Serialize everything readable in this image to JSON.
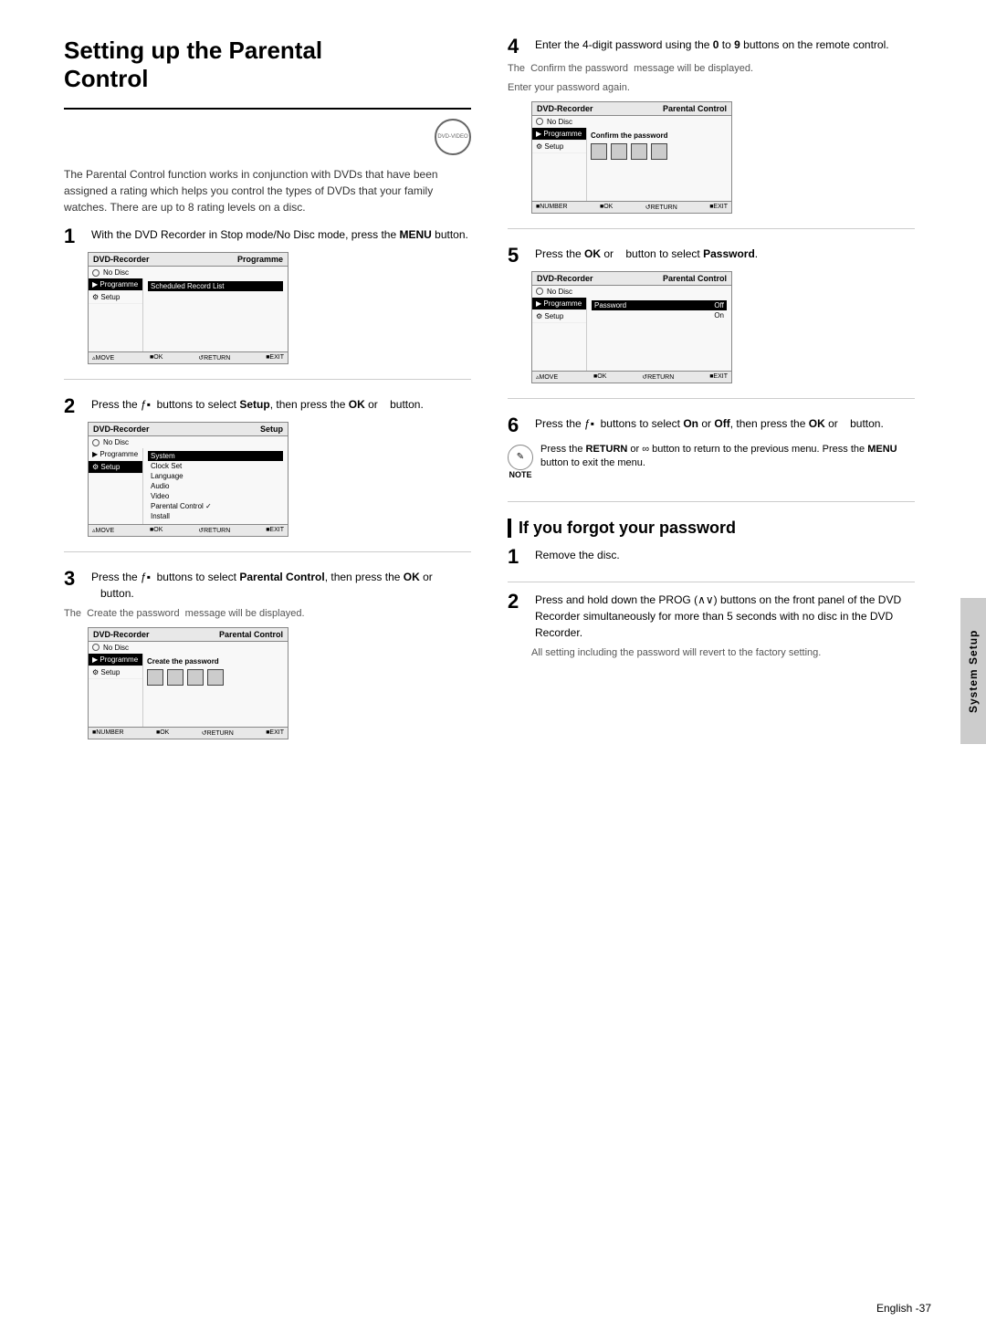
{
  "page": {
    "title": "Setting up the Parental Control",
    "sidebar_label": "System Setup",
    "footer": "English -37"
  },
  "left_col": {
    "section_title_line1": "Setting up the Parental",
    "section_title_line2": "Control",
    "intro_text": "The Parental Control function works in conjunction with DVDs that have been assigned a rating which helps you control the types of DVDs that your family watches. There are up to 8 rating levels on a disc.",
    "dvd_icon_label": "DVD-VIDEO",
    "steps": [
      {
        "num": "1",
        "text": "With the DVD Recorder in Stop mode/No Disc mode, press the ",
        "bold": "MENU",
        "text2": " button.",
        "screen": {
          "header_left": "DVD-Recorder",
          "header_right": "Programme",
          "no_disc": "No Disc",
          "left_items": [
            "Programme",
            "Setup"
          ],
          "right_items": [
            "Scheduled Record List"
          ],
          "footer": "MOVE  OK  RETURN  EXIT"
        }
      },
      {
        "num": "2",
        "text_pre": "Press the ƒ▪  buttons to select ",
        "bold1": "Setup",
        "text_mid": ", then press the ",
        "bold2": "OK",
        "text_post": " or    button.",
        "screen": {
          "header_left": "DVD-Recorder",
          "header_right": "Setup",
          "no_disc": "No Disc",
          "left_items": [
            "Programme",
            "Setup"
          ],
          "left_active": "Setup",
          "right_items": [
            "System",
            "Clock Set",
            "Language",
            "Audio",
            "Video",
            "Parental Control ✓",
            "Install"
          ],
          "right_active": "System",
          "footer": "MOVE  OK  RETURN  EXIT"
        }
      },
      {
        "num": "3",
        "text_pre": "Press the ƒ▪  buttons to select ",
        "bold1": "Parental Control",
        "text_mid": ", then press the ",
        "bold2": "OK",
        "text_post": " or    button.",
        "sub_text": "The  Create the password  message will be displayed.",
        "screen": {
          "header_left": "DVD-Recorder",
          "header_right": "Parental Control",
          "no_disc": "No Disc",
          "left_items": [
            "Programme",
            "Setup"
          ],
          "left_active": "Programme",
          "right_label": "Create the password",
          "show_password_boxes": true,
          "footer": "NUMBER  OK  RETURN  EXIT"
        }
      }
    ]
  },
  "right_col": {
    "steps": [
      {
        "num": "4",
        "text_pre": "Enter the 4-digit password using the ",
        "bold1": "0",
        "text_mid": " to ",
        "bold2": "9",
        "text_post": " buttons on the remote control.",
        "sub_text1": "The  Confirm the password  message will be displayed.",
        "sub_text2": "Enter your password again.",
        "screen": {
          "header_left": "DVD-Recorder",
          "header_right": "Parental Control",
          "no_disc": "No Disc",
          "left_items": [
            "Programme",
            "Setup"
          ],
          "left_active": "Programme",
          "right_label": "Confirm the password",
          "show_password_boxes": true,
          "footer": "NUMBER  OK  RETURN  EXIT"
        }
      },
      {
        "num": "5",
        "text_pre": "Press the ",
        "bold1": "OK",
        "text_mid": " or    button to select ",
        "bold2": "Password",
        "text_post": ".",
        "screen": {
          "header_left": "DVD-Recorder",
          "header_right": "Parental Control",
          "no_disc": "No Disc",
          "left_items": [
            "Programme",
            "Setup"
          ],
          "left_active": "Programme",
          "right_items": [
            "Password",
            "Off",
            "On"
          ],
          "right_active": "Password",
          "show_onoff": true,
          "footer": "MOVE  OK  RETURN  EXIT"
        }
      },
      {
        "num": "6",
        "text_pre": "Press the ƒ▪  buttons to select ",
        "bold1": "On",
        "text_mid": " or ",
        "bold2": "Off",
        "text_post": ", then press the ",
        "bold3": "OK",
        "text_end": " or    button.",
        "note": {
          "icon": "✎",
          "label": "NOTE",
          "text": "Press the RETURN or ∞ button to return to the previous menu. Press the MENU button to exit the menu."
        }
      }
    ],
    "forgot_section": {
      "heading": "If you forgot your password",
      "steps": [
        {
          "num": "1",
          "text": "Remove the disc."
        },
        {
          "num": "2",
          "text_pre": "Press and hold down the PROG (∧∨) buttons on the front panel of the DVD Recorder simultaneously for more than 5 seconds with no disc in the DVD Recorder.",
          "sub_text": "All setting including the password will revert to the factory setting."
        }
      ]
    }
  }
}
